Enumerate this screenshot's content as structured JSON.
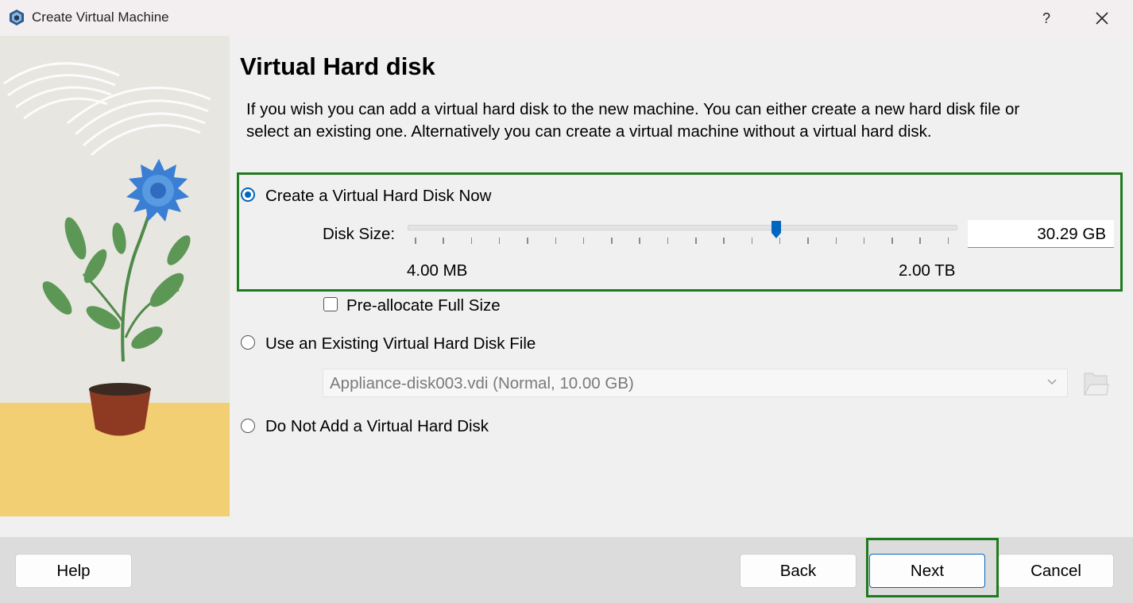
{
  "window": {
    "title": "Create Virtual Machine",
    "help_glyph": "?",
    "close_glyph": "✕",
    "icon": "virtualbox-icon"
  },
  "page": {
    "heading": "Virtual Hard disk",
    "description": "If you wish you can add a virtual hard disk to the new machine. You can either create a new hard disk file or select an existing one. Alternatively you can create a virtual machine without a virtual hard disk."
  },
  "options": {
    "create_new": {
      "label": "Create a Virtual Hard Disk Now",
      "selected": true
    },
    "use_existing": {
      "label": "Use an Existing Virtual Hard Disk File",
      "selected": false
    },
    "no_disk": {
      "label": "Do Not Add a Virtual Hard Disk",
      "selected": false
    }
  },
  "disk_size": {
    "label": "Disk Size:",
    "value": "30.29 GB",
    "min_label": "4.00 MB",
    "max_label": "2.00 TB",
    "slider_fraction": 0.67
  },
  "preallocate": {
    "label": "Pre-allocate Full Size",
    "checked": false
  },
  "existing_file": {
    "selected": "Appliance-disk003.vdi (Normal, 10.00 GB)"
  },
  "buttons": {
    "help": "Help",
    "back": "Back",
    "next": "Next",
    "cancel": "Cancel"
  },
  "colors": {
    "accent": "#0067c0",
    "highlight": "#1e7a1e",
    "illustration_floor": "#f2cf73"
  }
}
